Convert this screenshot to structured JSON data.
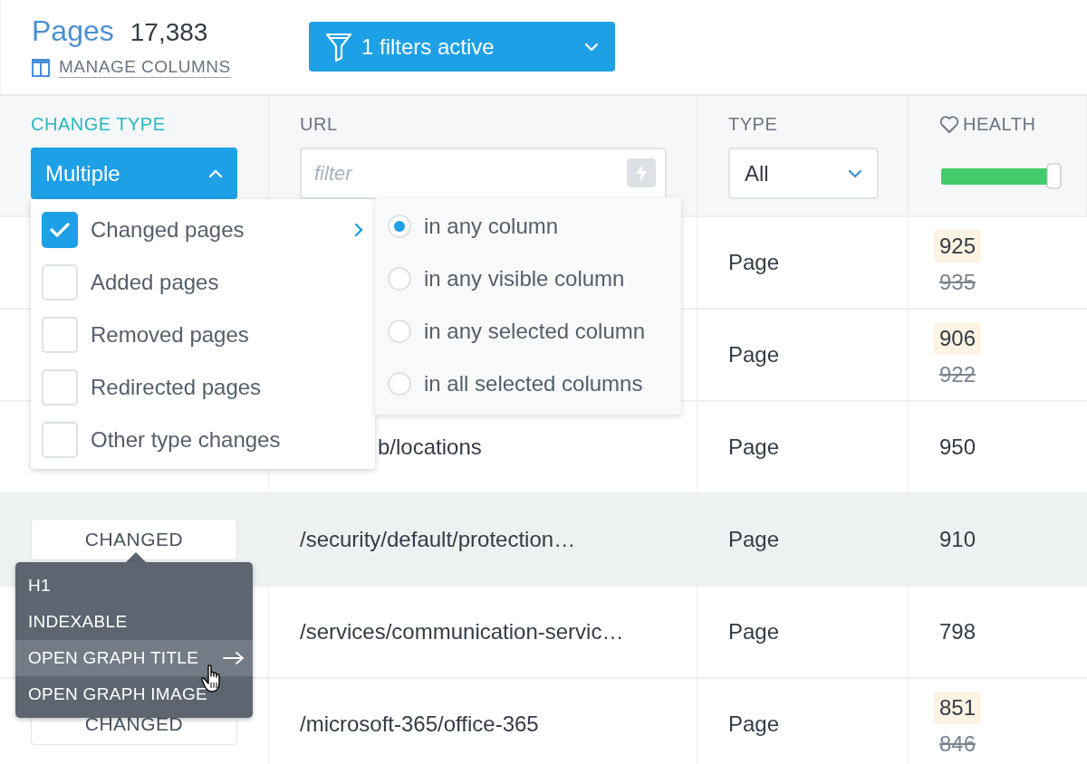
{
  "header": {
    "title": "Pages",
    "count": "17,383",
    "manage_columns": "MANAGE COLUMNS",
    "filter_button": "1 filters active"
  },
  "columns": [
    {
      "kind": "select",
      "label": "CHANGE TYPE",
      "active": true,
      "value": "Multiple",
      "open": true
    },
    {
      "kind": "search",
      "label": "URL",
      "active": false,
      "placeholder": "filter"
    },
    {
      "kind": "select",
      "label": "TYPE",
      "active": false,
      "value": "All",
      "open": false
    },
    {
      "kind": "slider",
      "label": "HEALTH",
      "active": false,
      "level": 1
    }
  ],
  "change_type_menu": [
    {
      "label": "Changed pages",
      "checked": true,
      "submenu": true
    },
    {
      "label": "Added pages",
      "checked": false,
      "submenu": false
    },
    {
      "label": "Removed pages",
      "checked": false,
      "submenu": false
    },
    {
      "label": "Redirected pages",
      "checked": false,
      "submenu": false
    },
    {
      "label": "Other type changes",
      "checked": false,
      "submenu": false
    }
  ],
  "match_menu": [
    {
      "label": "in any column",
      "selected": true
    },
    {
      "label": "in any visible column",
      "selected": false
    },
    {
      "label": "in any selected column",
      "selected": false
    },
    {
      "label": "in all selected columns",
      "selected": false
    }
  ],
  "rows": [
    {
      "type": "Page",
      "health": "925",
      "health_previous": "935",
      "highlighted": false
    },
    {
      "type": "Page",
      "health": "906",
      "health_previous": "922",
      "highlighted": false
    },
    {
      "url": "b/locations",
      "url_covered": true,
      "type": "Page",
      "health": "950",
      "highlighted": false
    },
    {
      "change": "CHANGED",
      "url": "/security/default/protection…",
      "type": "Page",
      "health": "910",
      "highlighted": true
    },
    {
      "url": "/services/communication-servic…",
      "type": "Page",
      "health": "798",
      "highlighted": false
    },
    {
      "change": "CHANGED",
      "url": "/microsoft-365/office-365",
      "type": "Page",
      "health": "851",
      "health_previous": "846",
      "highlighted": false
    }
  ],
  "change_tooltip": [
    {
      "label": "H1",
      "hovered": false
    },
    {
      "label": "INDEXABLE",
      "hovered": false
    },
    {
      "label": "OPEN GRAPH TITLE",
      "hovered": true
    },
    {
      "label": "OPEN GRAPH IMAGE",
      "hovered": false
    }
  ]
}
